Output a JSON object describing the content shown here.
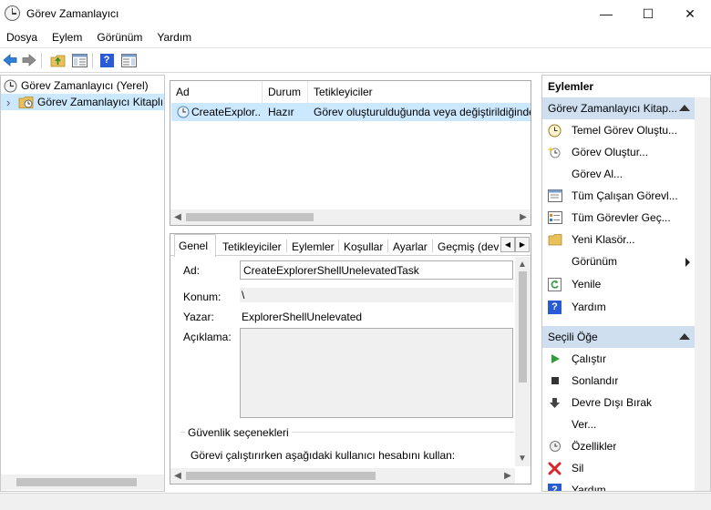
{
  "window": {
    "title": "Görev Zamanlayıcı",
    "minimize_glyph": "—",
    "maximize_glyph": "☐",
    "close_glyph": "✕"
  },
  "menu": [
    "Dosya",
    "Eylem",
    "Görünüm",
    "Yardım"
  ],
  "toolbar": {
    "buttons": [
      "back-icon",
      "forward-icon",
      "up-folder-icon",
      "show-hide-console-tree-icon",
      "help-icon",
      "show-hide-action-pane-icon"
    ],
    "help_glyph": "?"
  },
  "tree": {
    "root": "Görev Zamanlayıcı (Yerel)",
    "library": "Görev Zamanlayıcı Kitaplı",
    "expand_glyph": "›"
  },
  "task_list": {
    "columns": [
      "Ad",
      "Durum",
      "Tetikleyiciler"
    ],
    "rows": [
      {
        "name": "CreateExplor...",
        "status": "Hazır",
        "triggers": "Görev oluşturulduğunda veya değiştirildiğinde"
      }
    ]
  },
  "details": {
    "tabs": [
      "Genel",
      "Tetikleyiciler",
      "Eylemler",
      "Koşullar",
      "Ayarlar",
      "Geçmiş (devr"
    ],
    "active_tab": "Genel",
    "fields": {
      "name_label": "Ad:",
      "name_value": "CreateExplorerShellUnelevatedTask",
      "location_label": "Konum:",
      "location_value": "\\",
      "author_label": "Yazar:",
      "author_value": "ExplorerShellUnelevated",
      "description_label": "Açıklama:"
    },
    "security": {
      "group_label": "Güvenlik seçenekleri",
      "run_as_text": "Görevi çalıştırırken aşağıdaki kullanıcı hesabını kullan:"
    }
  },
  "actions_pane": {
    "title": "Eylemler",
    "section1_title": "Görev Zamanlayıcı Kitap...",
    "section1_items": [
      {
        "label": "Temel Görev Oluştu...",
        "icon": "basic-task-icon"
      },
      {
        "label": "Görev Oluştur...",
        "icon": "create-task-icon"
      },
      {
        "label": "Görev Al...",
        "icon": ""
      },
      {
        "label": "Tüm Çalışan Görevl...",
        "icon": "running-tasks-icon"
      },
      {
        "label": "Tüm Görevler Geç...",
        "icon": "task-history-icon"
      },
      {
        "label": "Yeni Klasör...",
        "icon": "new-folder-icon"
      },
      {
        "label": "Görünüm",
        "icon": ""
      },
      {
        "label": "Yenile",
        "icon": "refresh-icon"
      },
      {
        "label": "Yardım",
        "icon": "help-icon"
      }
    ],
    "section2_title": "Seçili Öğe",
    "section2_items": [
      {
        "label": "Çalıştır",
        "icon": "run-icon"
      },
      {
        "label": "Sonlandır",
        "icon": "end-icon"
      },
      {
        "label": "Devre Dışı Bırak",
        "icon": "disable-icon"
      },
      {
        "label": "Ver...",
        "icon": ""
      },
      {
        "label": "Özellikler",
        "icon": "properties-icon"
      },
      {
        "label": "Sil",
        "icon": "delete-icon"
      },
      {
        "label": "Yardım",
        "icon": "help-icon"
      }
    ]
  },
  "colors": {
    "selection": "#cce8ff",
    "section_header": "#cfdff0",
    "help_blue": "#2a5bd7",
    "delete_red": "#d9262a",
    "run_green": "#2f9e3a"
  }
}
